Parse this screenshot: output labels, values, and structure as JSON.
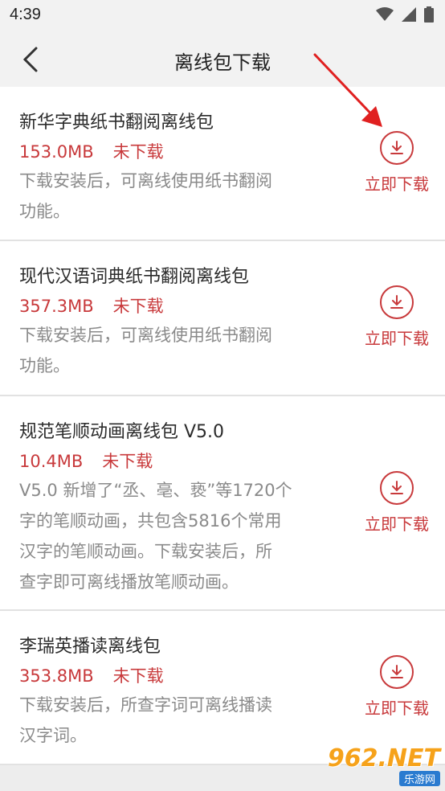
{
  "status": {
    "time": "4:39"
  },
  "nav": {
    "title": "离线包下载"
  },
  "items": [
    {
      "title": "新华字典纸书翻阅离线包",
      "size": "153.0MB",
      "state": "未下载",
      "desc_lines": [
        "下载安装后，可离线使用纸书翻阅",
        "功能。"
      ],
      "action": "立即下载"
    },
    {
      "title": "现代汉语词典纸书翻阅离线包",
      "size": "357.3MB",
      "state": "未下载",
      "desc_lines": [
        "下载安装后，可离线使用纸书翻阅",
        "功能。"
      ],
      "action": "立即下载"
    },
    {
      "title": "规范笔顺动画离线包 V5.0",
      "size": "10.4MB",
      "state": "未下载",
      "desc_lines": [
        "V5.0 新增了“丞、亳、亵”等1720个",
        "字的笔顺动画，共包含5816个常用",
        "汉字的笔顺动画。下载安装后，所",
        "查字即可离线播放笔顺动画。"
      ],
      "action": "立即下载"
    },
    {
      "title": "李瑞英播读离线包",
      "size": "353.8MB",
      "state": "未下载",
      "desc_lines": [
        "下载安装后，所查字词可离线播读",
        "汉字词。"
      ],
      "action": "立即下载"
    }
  ],
  "watermark": {
    "main": "962.NET",
    "sub": "乐游网"
  },
  "colors": {
    "accent": "#c8393b",
    "arrow": "#e02020"
  }
}
